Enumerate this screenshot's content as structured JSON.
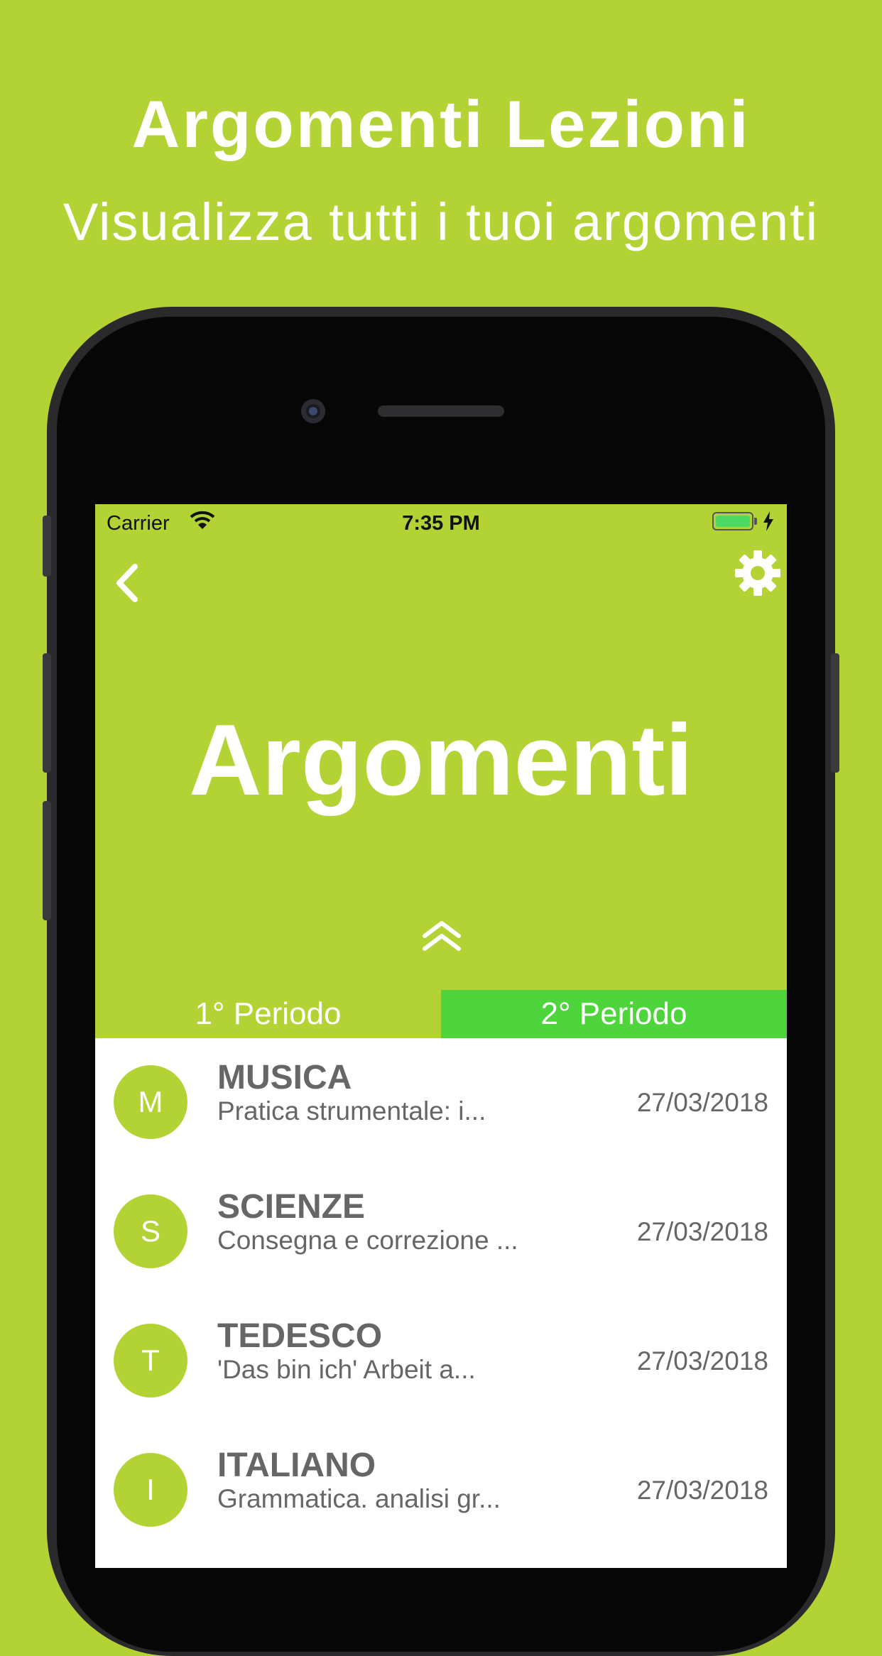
{
  "promo": {
    "title": "Argomenti Lezioni",
    "subtitle": "Visualizza tutti i tuoi argomenti"
  },
  "status_bar": {
    "carrier": "Carrier",
    "time": "7:35 PM",
    "battery_color": "#4cd964"
  },
  "nav": {
    "back_icon": "chevron-left-icon",
    "settings_icon": "gear-icon"
  },
  "header": {
    "title": "Argomenti",
    "collapse_icon": "double-chevron-up-icon"
  },
  "tabs": [
    {
      "label": "1° Periodo",
      "active": false
    },
    {
      "label": "2° Periodo",
      "active": true
    }
  ],
  "items": [
    {
      "initial": "M",
      "subject": "MUSICA",
      "description": "Pratica strumentale: i...",
      "date": "27/03/2018"
    },
    {
      "initial": "S",
      "subject": "SCIENZE",
      "description": "Consegna e correzione ...",
      "date": "27/03/2018"
    },
    {
      "initial": "T",
      "subject": "TEDESCO",
      "description": "'Das bin ich' Arbeit a...",
      "date": "27/03/2018"
    },
    {
      "initial": "I",
      "subject": "ITALIANO",
      "description": "Grammatica. analisi gr...",
      "date": "27/03/2018"
    }
  ],
  "colors": {
    "brand_green": "#b3d335",
    "active_tab": "#4fd53c",
    "text_gray": "#666666"
  }
}
